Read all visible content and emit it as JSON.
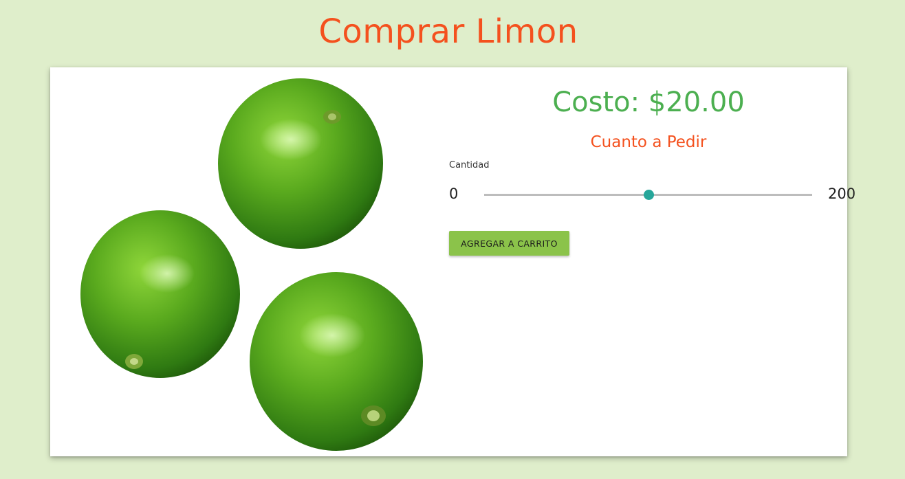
{
  "page": {
    "title": "Comprar Limon"
  },
  "product": {
    "cost_text": "Costo: $20.00",
    "order_prompt": "Cuanto a Pedir",
    "image_icon": "limes-photo"
  },
  "quantity": {
    "label": "Cantidad",
    "min": 0,
    "max": 200,
    "value": 100,
    "min_label": "0",
    "max_label": "200"
  },
  "actions": {
    "add_to_cart_label": "AGREGAR A CARRITO"
  },
  "colors": {
    "background": "#dfeecb",
    "title": "#f4511e",
    "cost": "#4caf50",
    "slider_thumb": "#26a69a",
    "button": "#8bc34a"
  }
}
